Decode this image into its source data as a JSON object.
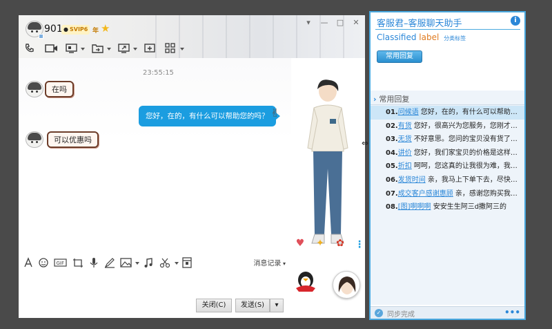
{
  "contact": {
    "name": "901",
    "vip_badge": "SVIP6",
    "year_label": "年"
  },
  "window_controls": [
    "▾",
    "—",
    "□",
    "✕"
  ],
  "header_tools": [
    "phone-icon",
    "video-icon",
    "screen-share-icon",
    "file-transfer-icon",
    "remote-desktop-icon",
    "add-member-icon",
    "apps-icon"
  ],
  "chat": {
    "timestamp": "23:55:15",
    "messages": [
      {
        "from": "contact",
        "text": "在吗"
      },
      {
        "from": "me",
        "text": "您好，在的，有什么可以帮助您的吗？"
      },
      {
        "from": "contact",
        "text": "可以优惠吗"
      }
    ]
  },
  "input_tools": [
    "font-icon",
    "emoji-icon",
    "gif-icon",
    "screenshot-icon",
    "voice-icon",
    "doodle-icon",
    "image-icon",
    "music-icon",
    "scissors-icon",
    "red-packet-icon"
  ],
  "history_label": "消息记录",
  "buttons": {
    "close": "关闭(C)",
    "send": "发送(S)",
    "send_dropdown": "▾"
  },
  "assistant": {
    "title": "客服君–客服聊天助手",
    "classified_word": "Classified",
    "label_word": "label",
    "classified_sub": "分类标签",
    "common_reply_button": "常用回复",
    "reply_header": "常用回复",
    "replies": [
      {
        "num": "01.",
        "tag": "问候语",
        "text": " 您好，在的，有什么可以帮助您的..."
      },
      {
        "num": "02.",
        "tag": "有货",
        "text": " 您好，很高兴为您服务，您刚才说的..."
      },
      {
        "num": "03.",
        "tag": "无货",
        "text": " 不好意思。您问的宝贝没有货了，..."
      },
      {
        "num": "04.",
        "tag": "讲价",
        "text": " 您好，我们家宝贝的价格是这样的，..."
      },
      {
        "num": "05.",
        "tag": "折扣",
        "text": " 呵呵，您这真的让我很为难，我请示..."
      },
      {
        "num": "06.",
        "tag": "发货时间",
        "text": " 亲，我马上下单下去，尽快给您..."
      },
      {
        "num": "07.",
        "tag": "成交客户感谢惠顾",
        "text": " 亲，感谢您购买我们的..."
      },
      {
        "num": "08.",
        "tag": "[图]啊啊啊",
        "text": " 安安生生阿三d撒阿三的"
      }
    ],
    "status": "同步完成"
  }
}
